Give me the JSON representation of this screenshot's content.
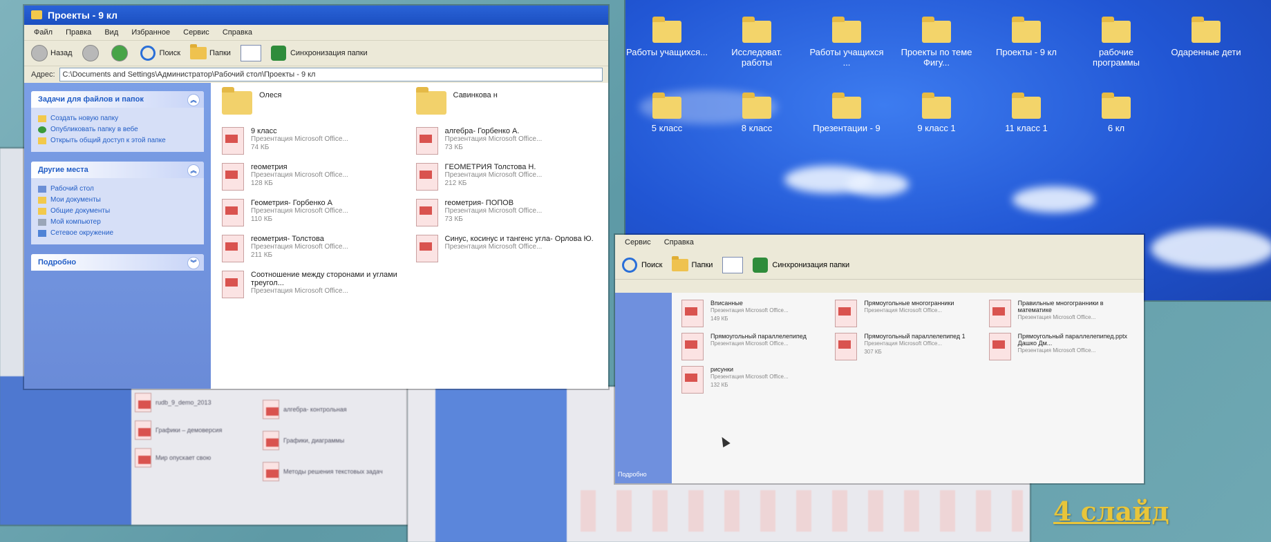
{
  "slide_label": "4 слайд",
  "explorer": {
    "title": "Проекты - 9 кл",
    "menu": [
      "Файл",
      "Правка",
      "Вид",
      "Избранное",
      "Сервис",
      "Справка"
    ],
    "toolbar": {
      "back": "Назад",
      "search": "Поиск",
      "folders": "Папки",
      "sync": "Синхронизация папки"
    },
    "address_label": "Адрес:",
    "address_path": "C:\\Documents and Settings\\Администратор\\Рабочий стол\\Проекты - 9 кл",
    "tasks": {
      "title": "Задачи для файлов и папок",
      "items": [
        "Создать новую папку",
        "Опубликовать папку в вебе",
        "Открыть общий доступ к этой папке"
      ]
    },
    "places": {
      "title": "Другие места",
      "items": [
        "Рабочий стол",
        "Мои документы",
        "Общие документы",
        "Мой компьютер",
        "Сетевое окружение"
      ]
    },
    "details": {
      "title": "Подробно"
    },
    "files": [
      {
        "name": "Олеся",
        "type": "",
        "size": "",
        "kind": "folder"
      },
      {
        "name": "Савинкова н",
        "type": "",
        "size": "",
        "kind": "folder"
      },
      {
        "name": "9 класс",
        "type": "Презентация Microsoft Office...",
        "size": "74 КБ",
        "kind": "ppt"
      },
      {
        "name": "алгебра- Горбенко А.",
        "type": "Презентация Microsoft Office...",
        "size": "73 КБ",
        "kind": "ppt"
      },
      {
        "name": "геометрия",
        "type": "Презентация Microsoft Office...",
        "size": "128 КБ",
        "kind": "ppt"
      },
      {
        "name": "ГЕОМЕТРИЯ     Толстова Н.",
        "type": "Презентация Microsoft Office...",
        "size": "212 КБ",
        "kind": "ppt"
      },
      {
        "name": "Геометрия- Горбенко А",
        "type": "Презентация Microsoft Office...",
        "size": "110 КБ",
        "kind": "ppt"
      },
      {
        "name": "геометрия- ПОПОВ",
        "type": "Презентация Microsoft Office...",
        "size": "73 КБ",
        "kind": "ppt"
      },
      {
        "name": "геометрия- Толстова",
        "type": "Презентация Microsoft Office...",
        "size": "211 КБ",
        "kind": "ppt"
      },
      {
        "name": "Синус, косинус и тангенс угла- Орлова Ю.",
        "type": "Презентация Microsoft Office...",
        "size": "",
        "kind": "ppt"
      },
      {
        "name": "Соотношение между сторонами и углами треугол...",
        "type": "Презентация Microsoft Office...",
        "size": "",
        "kind": "ppt"
      }
    ]
  },
  "desktop": {
    "icons_row1": [
      "Работы учащихся...",
      "Исследоват. работы",
      "Работы учащихся ...",
      "Проекты по теме Фигу...",
      "Проекты - 9 кл",
      "рабочие программы",
      "Одаренные дети"
    ],
    "icons_row2": [
      "5 класс",
      "8 класс",
      "Презентации - 9",
      "9 класс 1",
      "11 класс 1",
      "6 кл"
    ]
  },
  "explorer2": {
    "menu": [
      "Сервис",
      "Справка"
    ],
    "toolbar": {
      "search": "Поиск",
      "folders": "Папки",
      "sync": "Синхронизация папки"
    },
    "details": "Подробно",
    "files": [
      {
        "name": "Вписанные",
        "type": "Презентация Microsoft Office...",
        "size": "149 КБ"
      },
      {
        "name": "Прямоугольные многогранники",
        "type": "Презентация Microsoft Office...",
        "size": ""
      },
      {
        "name": "Правильные многогранники в математике",
        "type": "Презентация Microsoft Office...",
        "size": ""
      },
      {
        "name": "Прямоугольный параллелепипед",
        "type": "Презентация Microsoft Office...",
        "size": ""
      },
      {
        "name": "Прямоугольный параллелепипед 1",
        "type": "Презентация Microsoft Office...",
        "size": "307 КБ"
      },
      {
        "name": "Прямоугольный параллелепипед.pptx Дашко Дм...",
        "type": "Презентация Microsoft Office...",
        "size": ""
      },
      {
        "name": "рисунки",
        "type": "Презентация Microsoft Office...",
        "size": "132 КБ"
      }
    ]
  },
  "bg_left": {
    "files": [
      "rudb_9_demo_2013",
      "Графики – демоверсия",
      "Мир опускает свою",
      "алгебра- контрольная",
      "Графики, диаграммы",
      "Методы решения текстовых задач"
    ]
  }
}
